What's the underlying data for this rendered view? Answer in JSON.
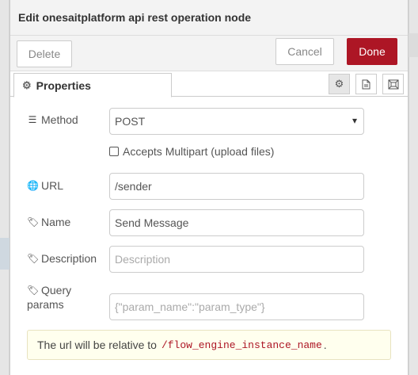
{
  "header": {
    "title": "Edit onesaitplatform api rest operation node"
  },
  "toolbar": {
    "delete_label": "Delete",
    "cancel_label": "Cancel",
    "done_label": "Done"
  },
  "tabs": {
    "properties_label": "Properties"
  },
  "form": {
    "method": {
      "label": "Method",
      "value": "POST"
    },
    "multipart": {
      "label": "Accepts Multipart (upload files)",
      "checked": false
    },
    "url": {
      "label": "URL",
      "value": "/sender"
    },
    "name": {
      "label": "Name",
      "value": "Send Message"
    },
    "description": {
      "label": "Description",
      "placeholder": "Description"
    },
    "query": {
      "label_line1": "Query",
      "label_line2": "params",
      "placeholder": "{\"param_name\":\"param_type\"}"
    }
  },
  "tip": {
    "text": "The url will be relative to",
    "path": "/flow_engine_instance_name",
    "suffix": "."
  },
  "colors": {
    "done_button": "#ad1625",
    "tip_background": "#ffffee"
  }
}
